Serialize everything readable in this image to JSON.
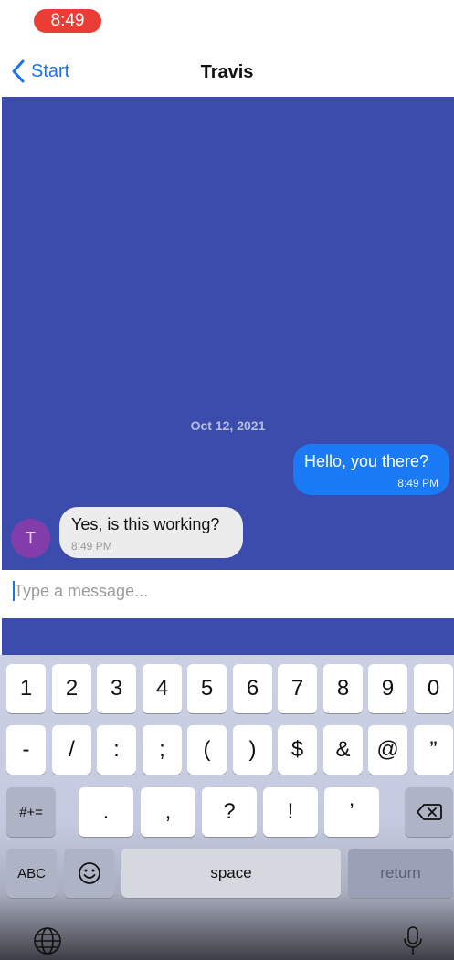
{
  "status_bar": {
    "time": "8:49"
  },
  "nav": {
    "back_label": "Start",
    "title": "Travis"
  },
  "chat": {
    "date_separator": "Oct 12, 2021",
    "messages": [
      {
        "direction": "outgoing",
        "text": "Hello, you there?",
        "time": "8:49 PM"
      },
      {
        "direction": "incoming",
        "sender_initial": "T",
        "text": "Yes, is this working?",
        "time": "8:49 PM"
      }
    ]
  },
  "composer": {
    "placeholder": "Type a message...",
    "value": ""
  },
  "keyboard": {
    "row1": [
      "1",
      "2",
      "3",
      "4",
      "5",
      "6",
      "7",
      "8",
      "9",
      "0"
    ],
    "row2": [
      "-",
      "/",
      ":",
      ";",
      "(",
      ")",
      "$",
      "&",
      "@",
      "”"
    ],
    "row3_toggle": "#+=",
    "row3": [
      ".",
      ",",
      "?",
      "!",
      "’"
    ],
    "abc_label": "ABC",
    "space_label": "space",
    "return_label": "return",
    "icons": {
      "backspace": "backspace-icon",
      "emoji": "emoji-icon",
      "globe": "globe-icon",
      "mic": "mic-icon"
    }
  },
  "colors": {
    "accent": "#1a73e8",
    "chat_background": "#3c4cac",
    "outgoing_bubble": "#1b7af5",
    "incoming_bubble": "#ececec",
    "avatar": "#833dab",
    "status_pill": "#ea3d35"
  }
}
